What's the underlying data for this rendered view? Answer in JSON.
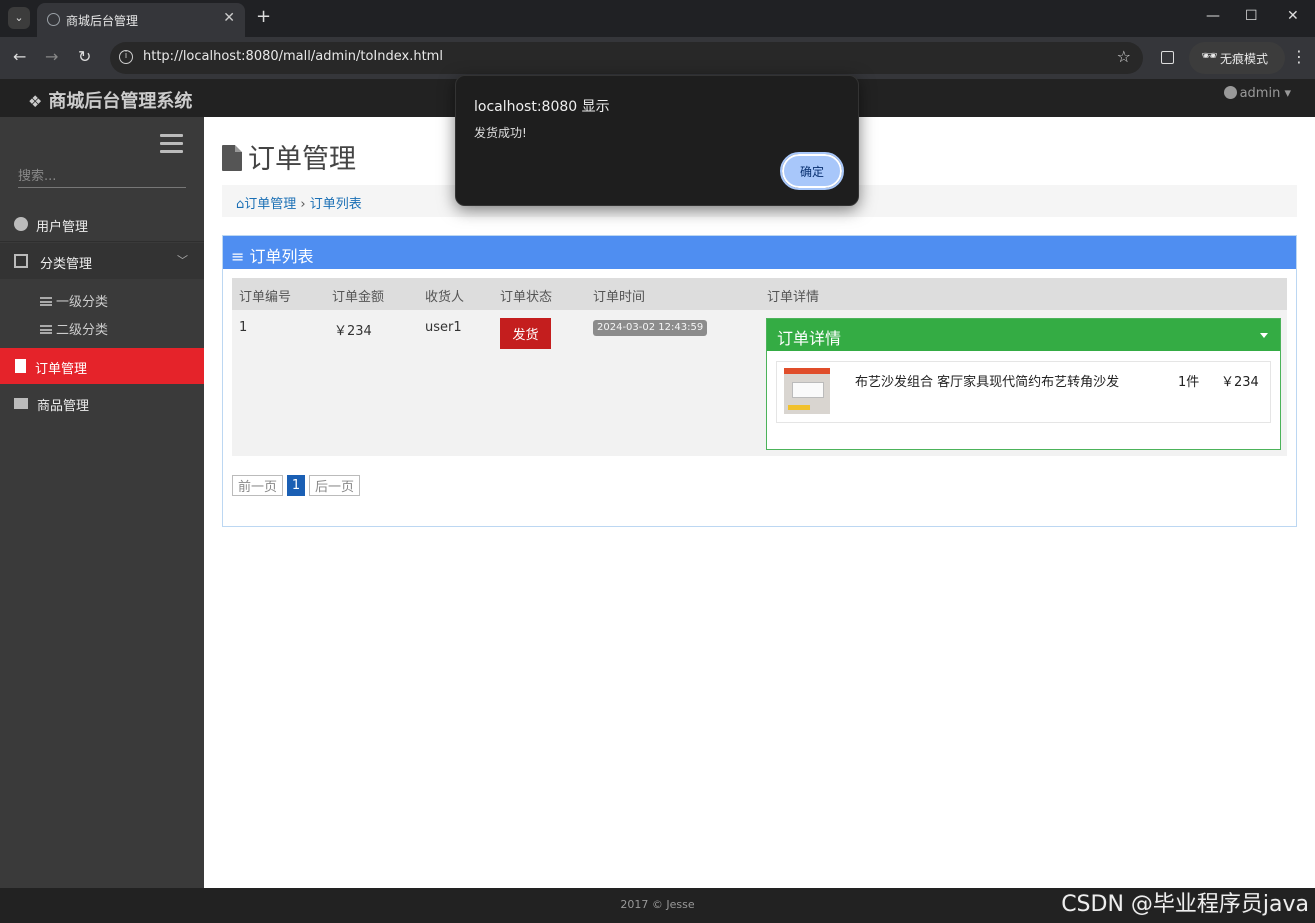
{
  "browser": {
    "tab_title": "商城后台管理",
    "url": "http://localhost:8080/mall/admin/toIndex.html",
    "incognito_label": "无痕模式"
  },
  "app": {
    "brand": "商城后台管理系统",
    "user": "admin"
  },
  "sidebar": {
    "search_placeholder": "搜索...",
    "items": [
      {
        "label": "用户管理"
      },
      {
        "label": "分类管理"
      },
      {
        "label": "订单管理"
      },
      {
        "label": "商品管理"
      }
    ],
    "sub_items": [
      {
        "label": "一级分类"
      },
      {
        "label": "二级分类"
      }
    ]
  },
  "main": {
    "page_title": "订单管理",
    "breadcrumb": {
      "root": "订单管理",
      "sep": "›",
      "current": "订单列表"
    },
    "panel_title": "≡ 订单列表",
    "table": {
      "headers": [
        "订单编号",
        "订单金额",
        "收货人",
        "订单状态",
        "订单时间",
        "订单详情"
      ],
      "rows": [
        {
          "id": "1",
          "amount": "￥234",
          "receiver": "user1",
          "status_button": "发货",
          "time": "2024-03-02 12:43:59",
          "detail": {
            "title": "订单详情",
            "items": [
              {
                "name": "布艺沙发组合 客厅家具现代简约布艺转角沙发",
                "qty": "1件",
                "price": "￥234"
              }
            ]
          }
        }
      ]
    },
    "pager": {
      "prev": "前一页",
      "current": "1",
      "next": "后一页"
    }
  },
  "footer": {
    "text": "2017 © Jesse"
  },
  "watermark": "CSDN @毕业程序员java",
  "dialog": {
    "host": "localhost:8080 显示",
    "message": "发货成功!",
    "ok_label": "确定"
  },
  "colors": {
    "accent_blue": "#4f8ef1",
    "active_red": "#e5232a",
    "detail_green": "#34ac44",
    "ship_red": "#c41e1e"
  }
}
